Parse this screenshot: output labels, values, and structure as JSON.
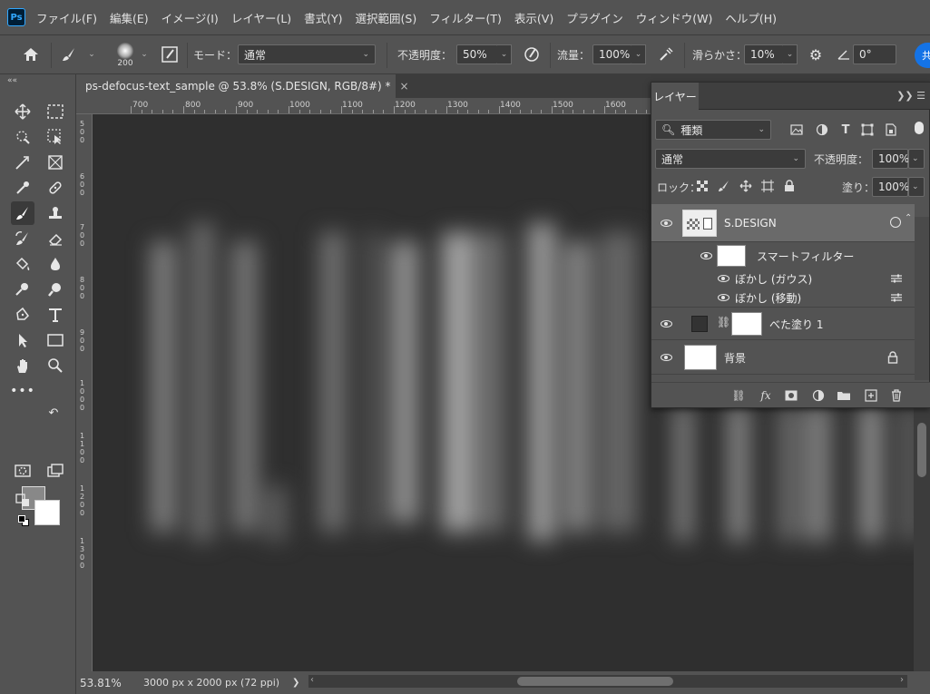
{
  "app": {
    "logo": "Ps"
  },
  "menu": [
    "ファイル(F)",
    "編集(E)",
    "イメージ(I)",
    "レイヤー(L)",
    "書式(Y)",
    "選択範囲(S)",
    "フィルター(T)",
    "表示(V)",
    "プラグイン",
    "ウィンドウ(W)",
    "ヘルプ(H)"
  ],
  "options": {
    "brush_size": "200",
    "mode_label": "モード：",
    "mode_value": "通常",
    "opacity_label": "不透明度：",
    "opacity_value": "50%",
    "flow_label": "流量：",
    "flow_value": "100%",
    "smoothing_label": "滑らかさ：",
    "smoothing_value": "10%",
    "angle_value": "0°",
    "share_label": "共"
  },
  "toolbar": {
    "collapse": "««"
  },
  "document": {
    "tab_title": "ps-defocus-text_sample @ 53.8% (S.DESIGN, RGB/8#) *",
    "close": "×",
    "ruler_top": [
      "700",
      "800",
      "900",
      "1000",
      "1100",
      "1200",
      "1300",
      "1400",
      "1500",
      "1600"
    ],
    "ruler_left": [
      "500",
      "600",
      "700",
      "800",
      "900",
      "1000",
      "1100",
      "1200",
      "1300"
    ]
  },
  "status": {
    "zoom": "53.81%",
    "doc_info": "3000 px x 2000 px (72 ppi)",
    "arrow": "❯"
  },
  "layers_panel": {
    "tab": "レイヤー",
    "controls": "❯❯ ☰",
    "search_value": "種類",
    "blend_value": "通常",
    "opacity_label": "不透明度：",
    "opacity_value": "100%",
    "lock_label": "ロック：",
    "fill_label": "塗り：",
    "fill_value": "100%",
    "layers": {
      "sdesign": "S.DESIGN",
      "smart_filter": "スマートフィルター",
      "gauss": "ぼかし (ガウス)",
      "motion": "ぼかし (移動)",
      "fill": "べた塗り 1",
      "background": "背景"
    }
  },
  "colors": {
    "accent": "#1473e6",
    "bg": "#535353",
    "canvas": "#2f2f2f"
  }
}
